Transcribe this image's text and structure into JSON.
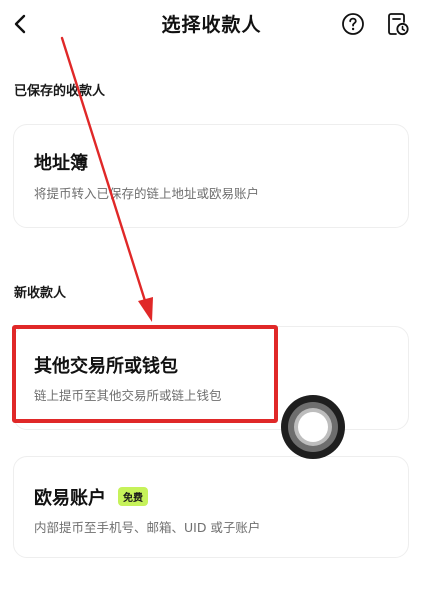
{
  "header": {
    "title": "选择收款人",
    "back_icon": "chevron-left-icon",
    "help_icon": "question-circle-icon",
    "history_icon": "document-clock-icon"
  },
  "saved_section": {
    "label": "已保存的收款人",
    "address_book": {
      "title": "地址簿",
      "description": "将提币转入已保存的链上地址或欧易账户"
    }
  },
  "new_section": {
    "label": "新收款人",
    "exchange_wallet": {
      "title": "其他交易所或钱包",
      "description": "链上提币至其他交易所或链上钱包"
    },
    "okx_account": {
      "title": "欧易账户",
      "badge": "免费",
      "description": "内部提币至手机号、邮箱、UID 或子账户"
    }
  },
  "colors": {
    "highlight": "#e02828",
    "arrow": "#e02828",
    "badge_bg": "#c6f25a"
  }
}
